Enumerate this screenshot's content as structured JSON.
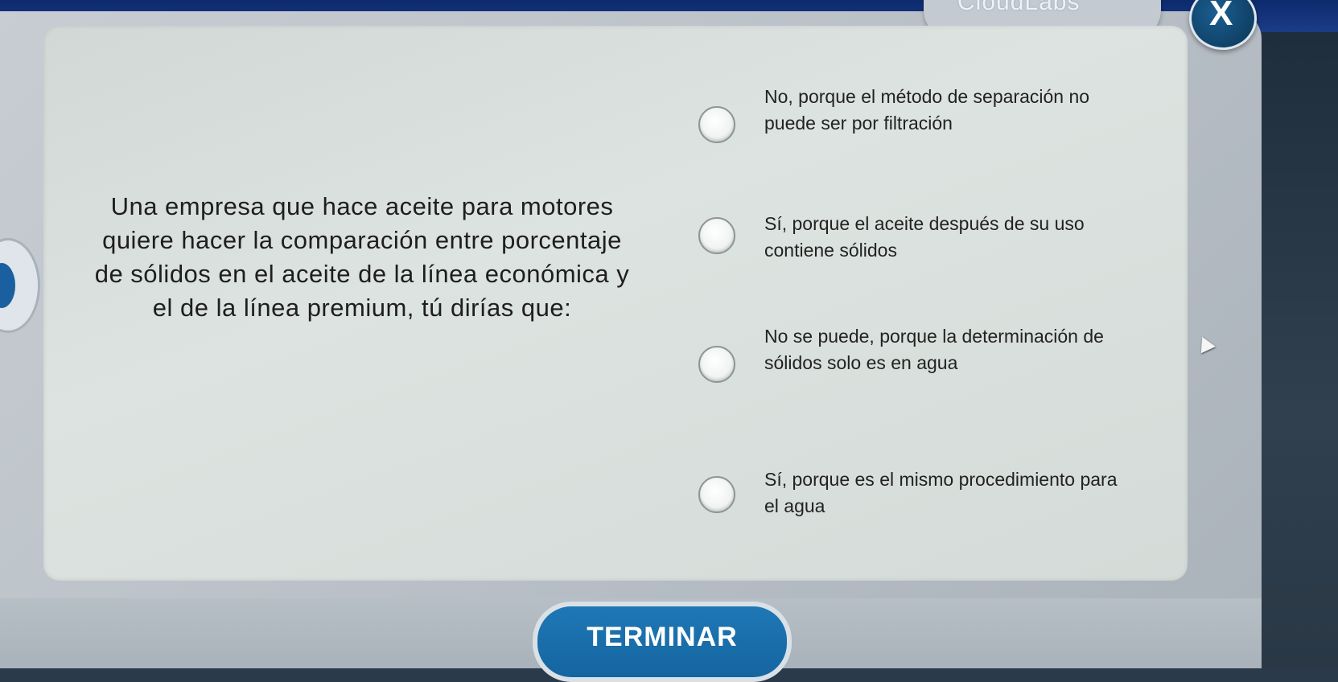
{
  "app": {
    "brand": "CloudLabs",
    "close_label": "X"
  },
  "question": {
    "text": "Una empresa que hace aceite para motores quiere hacer la comparación entre porcentaje de sólidos en el aceite de la línea económica y el de la línea premium, tú dirías que:"
  },
  "options": [
    {
      "label": "No, porque el método de separación no puede ser por filtración",
      "selected": false
    },
    {
      "label": "Sí, porque el aceite después de su uso contiene sólidos",
      "selected": false
    },
    {
      "label": "No se puede, porque la determinación de sólidos solo es en agua",
      "selected": false
    },
    {
      "label": "Sí, porque es el mismo procedimiento para el agua",
      "selected": false
    }
  ],
  "footer": {
    "finish_label": "TERMINAR"
  },
  "colors": {
    "accent": "#1565a0",
    "top_bar": "#0d2a6e"
  }
}
